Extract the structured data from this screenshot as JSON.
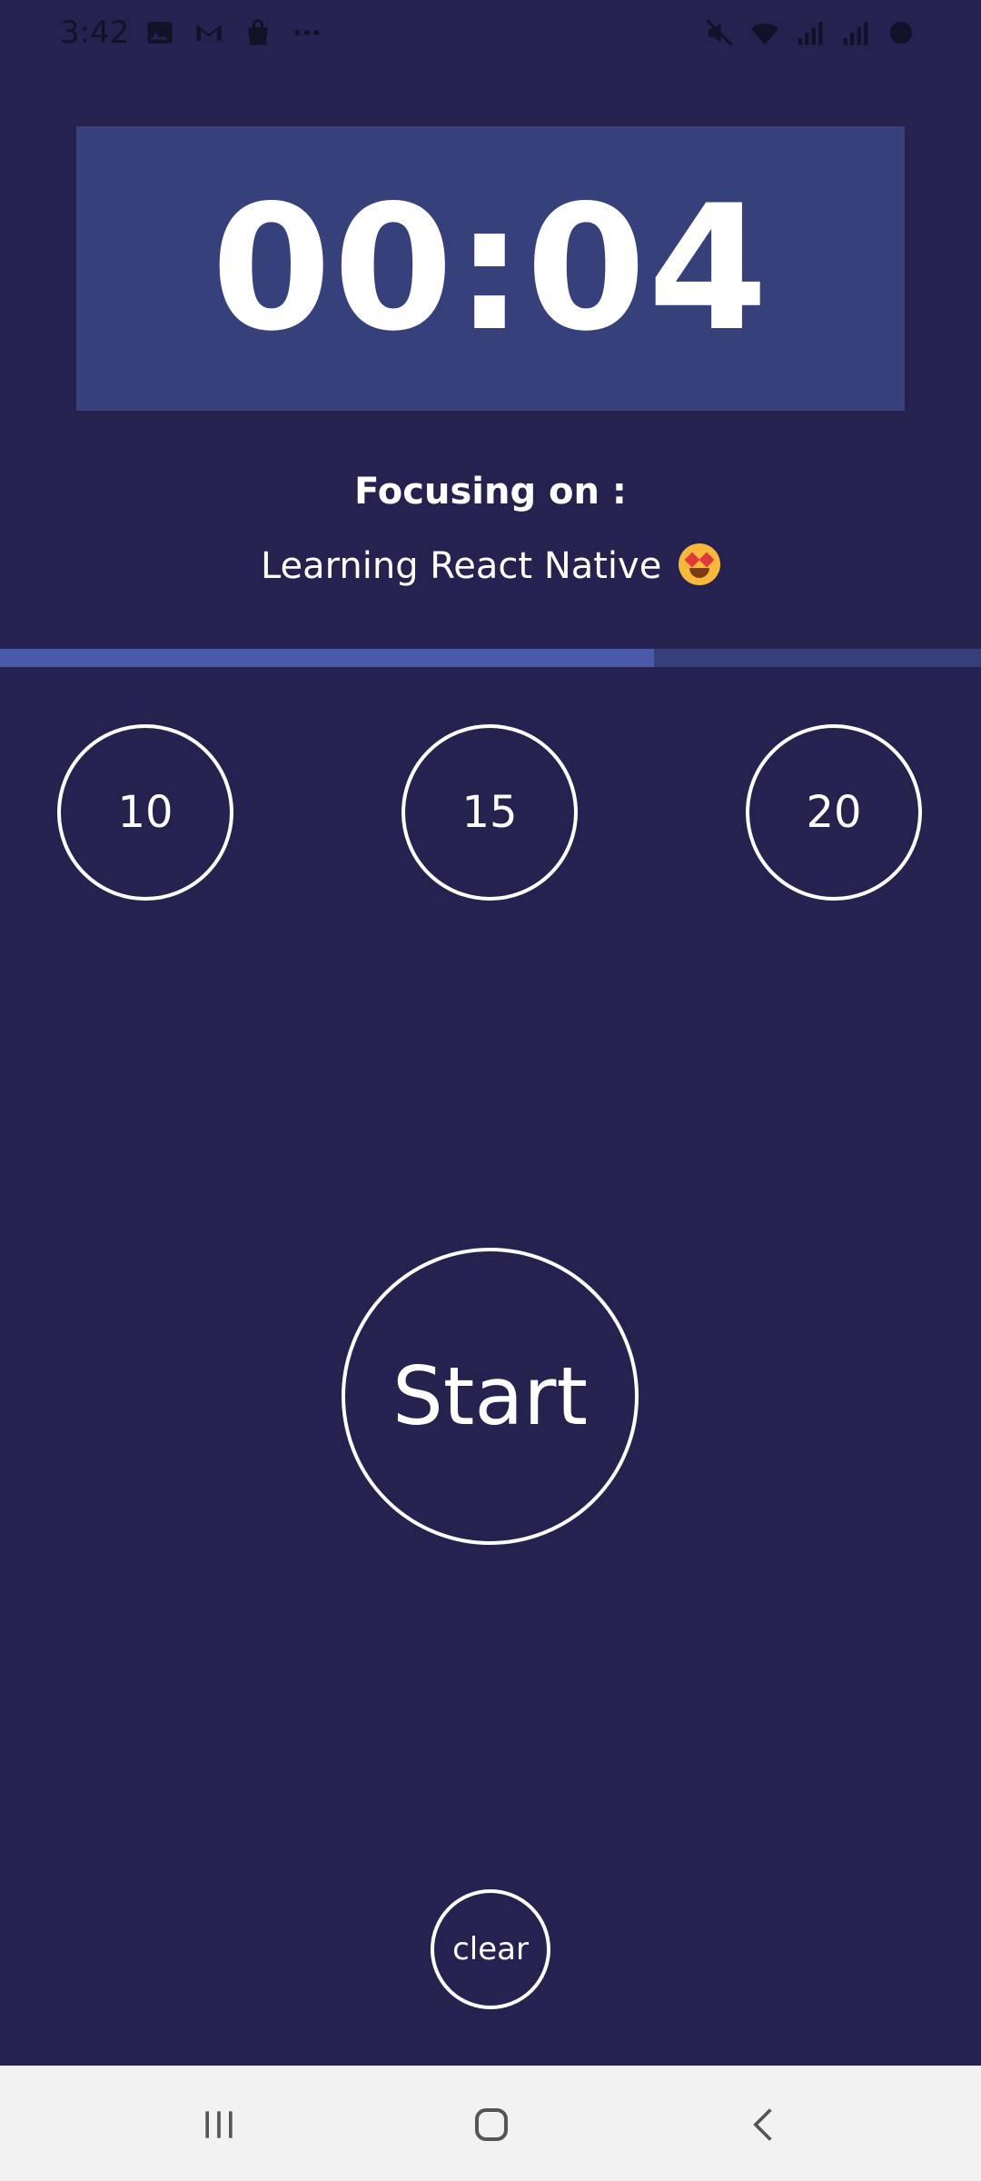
{
  "status_bar": {
    "time": "3:42",
    "left_icons": [
      "gallery-icon",
      "gmail-icon",
      "shopping-bag-icon",
      "more-dots-icon"
    ],
    "right_icons": [
      "mute-icon",
      "wifi-icon",
      "signal-icon",
      "signal-icon",
      "battery-icon"
    ]
  },
  "timer": {
    "display": "00:04"
  },
  "focus": {
    "label": "Focusing on :",
    "subject": "Learning React Native"
  },
  "progress": {
    "value": 0.667
  },
  "options": [
    {
      "label": "10"
    },
    {
      "label": "15"
    },
    {
      "label": "20"
    }
  ],
  "controls": {
    "start_label": "Start",
    "clear_label": "clear"
  },
  "colors": {
    "background": "#252250",
    "timer_box": "#36407b",
    "progress_fill": "#4a59a8"
  }
}
